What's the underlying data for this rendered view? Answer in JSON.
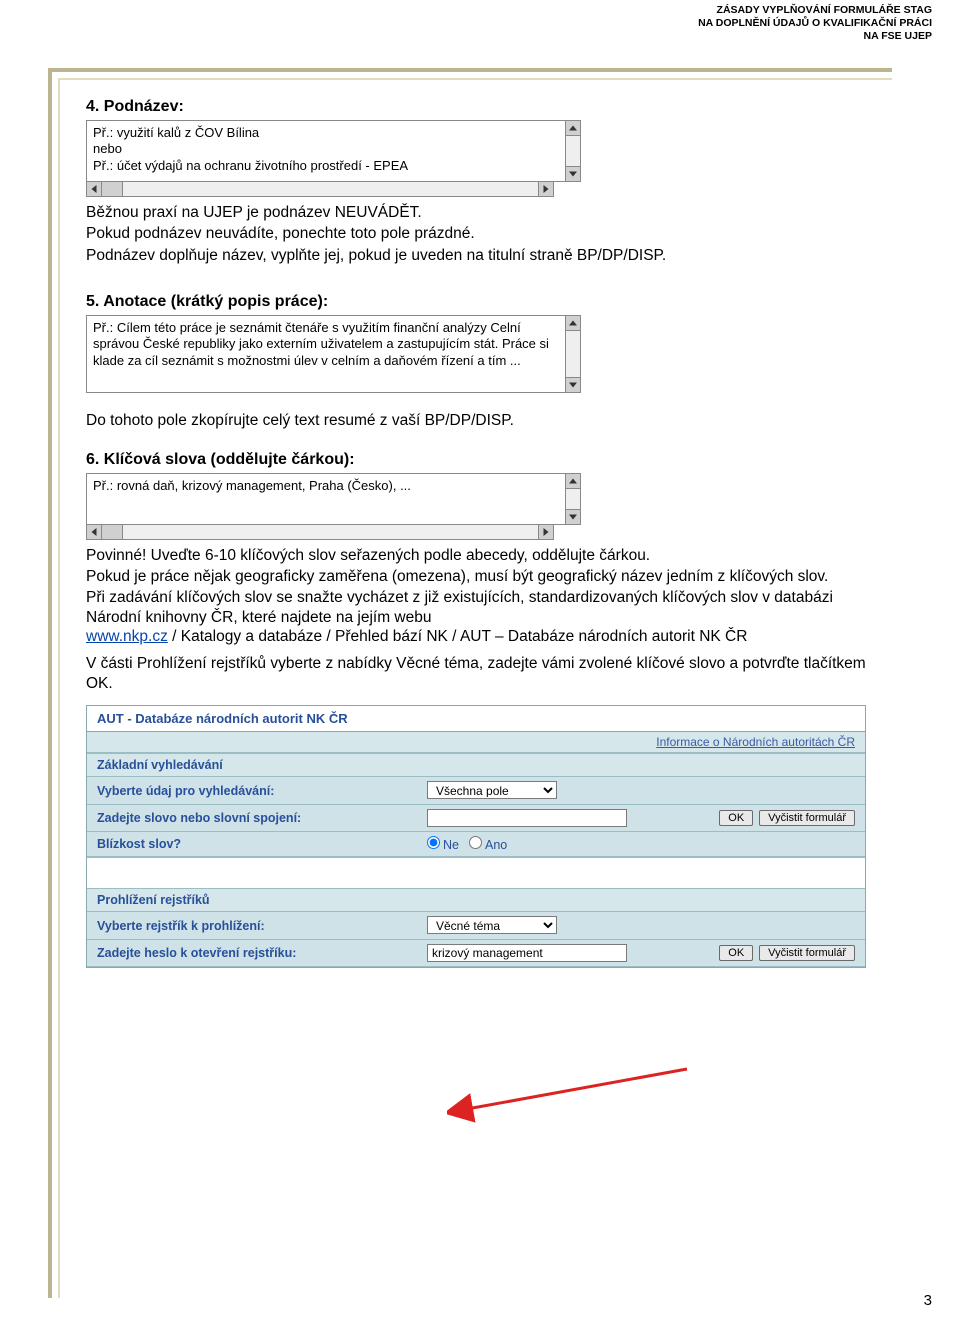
{
  "header": {
    "line1": "ZÁSADY VYPLŇOVÁNÍ FORMULÁŘE STAG",
    "line2": "NA DOPLNĚNÍ ÚDAJŮ O KVALIFIKAČNÍ PRÁCI",
    "line3": "NA FSE UJEP"
  },
  "section4": {
    "title": "4. Podnázev:",
    "textbox": "Př.: využití kalů z ČOV Bílina\nnebo\nPř.: účet výdajů na ochranu životního prostředí - EPEA",
    "para1": "Běžnou praxí na UJEP je podnázev NEUVÁDĚT.",
    "para2": "Pokud podnázev neuvádíte, ponechte toto pole prázdné.",
    "para3": "Podnázev doplňuje název, vyplňte jej, pokud je uveden na titulní straně BP/DP/DISP."
  },
  "section5": {
    "title": "5. Anotace (krátký popis práce):",
    "textbox": "Př.: Cílem této práce je seznámit čtenáře s využitím finanční analýzy Celní správou České republiky jako externím uživatelem a zastupujícím stát. Práce si klade za cíl seznámit s možnostmi úlev v celním a daňovém řízení a tím ...",
    "para1": "Do tohoto pole zkopírujte celý text resumé z vaší BP/DP/DISP."
  },
  "section6": {
    "title": "6. Klíčová slova (oddělujte čárkou):",
    "textbox": "Př.: rovná daň, krizový management, Praha (Česko), ...",
    "para1": "Povinné! Uveďte 6-10 klíčových slov seřazených podle abecedy, oddělujte čárkou.",
    "para2": "Pokud je práce nějak geograficky zaměřena (omezena), musí být geografický název jedním z klíčových slov.",
    "para3_a": "Při zadávání klíčových slov se snažte vycházet z již existujících, standardizovaných klíčových slov v databázi Národní knihovny ČR, které najdete na jejím webu",
    "link_text": "www.nkp.cz",
    "para3_b": " / Katalogy a databáze / Přehled bází NK / AUT – Databáze národních autorit NK ČR",
    "para4": "V části Prohlížení rejstříků vyberte z nabídky Věcné téma, zadejte vámi zvolené klíčové slovo a potvrďte tlačítkem OK."
  },
  "aut": {
    "title": "AUT - Databáze národních autorit NK ČR",
    "info_link": "Informace o Národních autoritách ČR",
    "sec1": "Základní vyhledávání",
    "row1_label": "Vyberte údaj pro vyhledávání:",
    "row1_select": "Všechna pole",
    "row2_label": "Zadejte slovo nebo slovní spojení:",
    "row2_value": "",
    "row3_label": "Blízkost slov?",
    "row3_ne": "Ne",
    "row3_ano": "Ano",
    "sec2": "Prohlížení rejstříků",
    "row4_label": "Vyberte rejstřík k prohlížení:",
    "row4_select": "Věcné téma",
    "row5_label": "Zadejte heslo k otevření rejstříku:",
    "row5_value": "krizový management",
    "btn_ok": "OK",
    "btn_clear": "Vyčistit formulář"
  },
  "page_number": "3"
}
